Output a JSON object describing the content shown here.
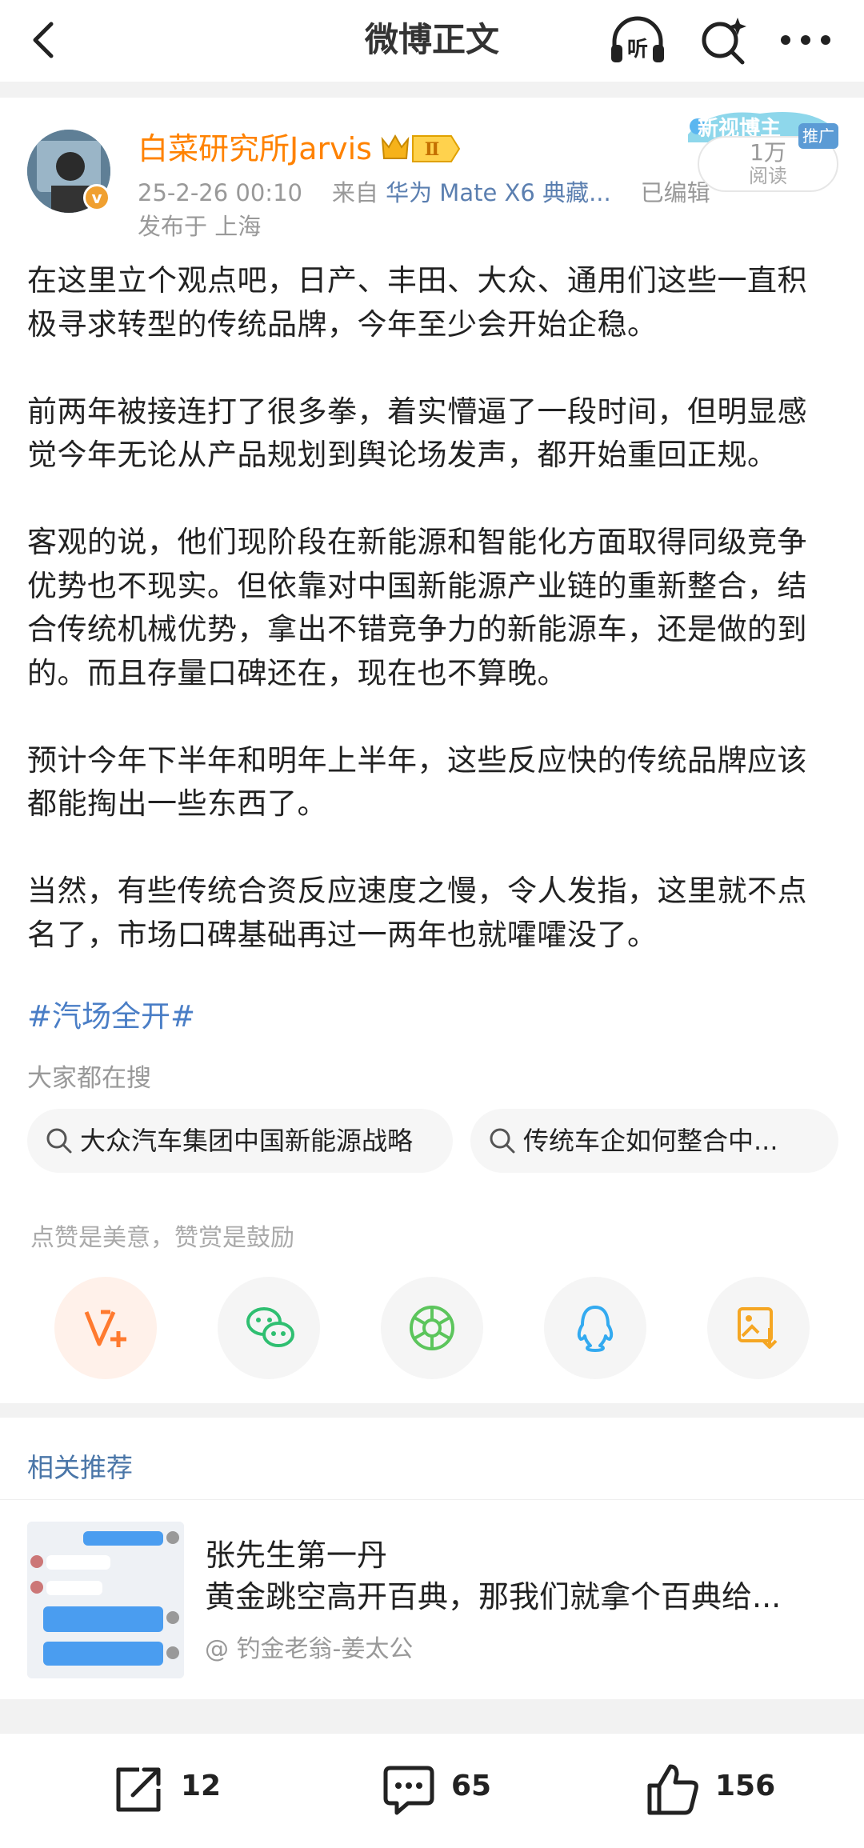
{
  "header": {
    "title": "微博正文",
    "back_icon": "chevron-left-icon",
    "listen_icon": "headphones-listen-icon",
    "listen_label": "听",
    "search_icon": "search-sparkle-icon",
    "more_icon": "more-dots-icon"
  },
  "author": {
    "name": "白菜研究所Jarvis",
    "level_badge": "Ⅱ",
    "verified_badge": "v",
    "timestamp": "25-2-26 00:10",
    "source_prefix": "来自",
    "source_device": "华为 Mate X6 典藏...",
    "edited": "已编辑",
    "location": "发布于 上海"
  },
  "promo": {
    "label": "新视博主",
    "tag": "推广",
    "reads_count": "1万",
    "reads_label": "阅读"
  },
  "post": {
    "paragraphs": [
      "在这里立个观点吧，日产、丰田、大众、通用们这些一直积极寻求转型的传统品牌，今年至少会开始企稳。",
      "前两年被接连打了很多拳，着实懵逼了一段时间，但明显感觉今年无论从产品规划到舆论场发声，都开始重回正规。",
      "客观的说，他们现阶段在新能源和智能化方面取得同级竞争优势也不现实。但依靠对中国新能源产业链的重新整合，结合传统机械优势，拿出不错竞争力的新能源车，还是做的到的。而且存量口碑还在，现在也不算晚。",
      "预计今年下半年和明年上半年，这些反应快的传统品牌应该都能掏出一些东西了。",
      "当然，有些传统合资反应速度之慢，令人发指，这里就不点名了，市场口碑基础再过一两年也就嚯嚯没了。"
    ],
    "hashtag": "#汽场全开#"
  },
  "searches": {
    "heading": "大家都在搜",
    "items": [
      "大众汽车集团中国新能源战略",
      "传统车企如何整合中..."
    ]
  },
  "share": {
    "hint": "点赞是美意，赞赏是鼓励",
    "buttons": [
      {
        "name": "reward-button",
        "icon": "reward-v-plus-icon",
        "color": "#ff7a2f"
      },
      {
        "name": "wechat-share-button",
        "icon": "wechat-icon",
        "color": "#2fbf71"
      },
      {
        "name": "moments-share-button",
        "icon": "moments-aperture-icon",
        "color": "#5cc55c"
      },
      {
        "name": "qq-share-button",
        "icon": "qq-penguin-icon",
        "color": "#33aaf0"
      },
      {
        "name": "save-image-button",
        "icon": "save-image-icon",
        "color": "#f5a623"
      }
    ]
  },
  "related": {
    "heading": "相关推荐",
    "item": {
      "title": "张先生第一丹",
      "desc": "黄金跳空高开百典，那我们就拿个百典给...",
      "source": "@ 钓金老翁-姜太公"
    }
  },
  "bottom_bar": {
    "repost_count": "12",
    "comment_count": "65",
    "like_count": "156"
  },
  "colors": {
    "accent_orange": "#ff8200",
    "link_blue": "#4a7ec6",
    "muted_gray": "#999999"
  }
}
